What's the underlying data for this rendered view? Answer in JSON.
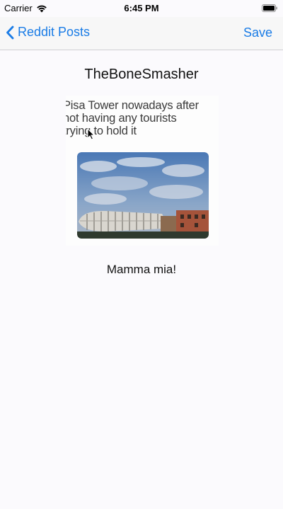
{
  "status_bar": {
    "carrier": "Carrier",
    "time": "6:45 PM",
    "wifi_icon": "wifi-icon",
    "battery_icon": "battery-icon"
  },
  "nav": {
    "back_label": "Reddit Posts",
    "back_icon": "chevron-left-icon",
    "save_label": "Save",
    "accent_color": "#1a7ce6"
  },
  "post": {
    "author": "TheBoneSmasher",
    "image_caption": "Pisa Tower nowadays after\nnot having any tourists\ntrying to hold it",
    "title": "Mamma mia!"
  }
}
